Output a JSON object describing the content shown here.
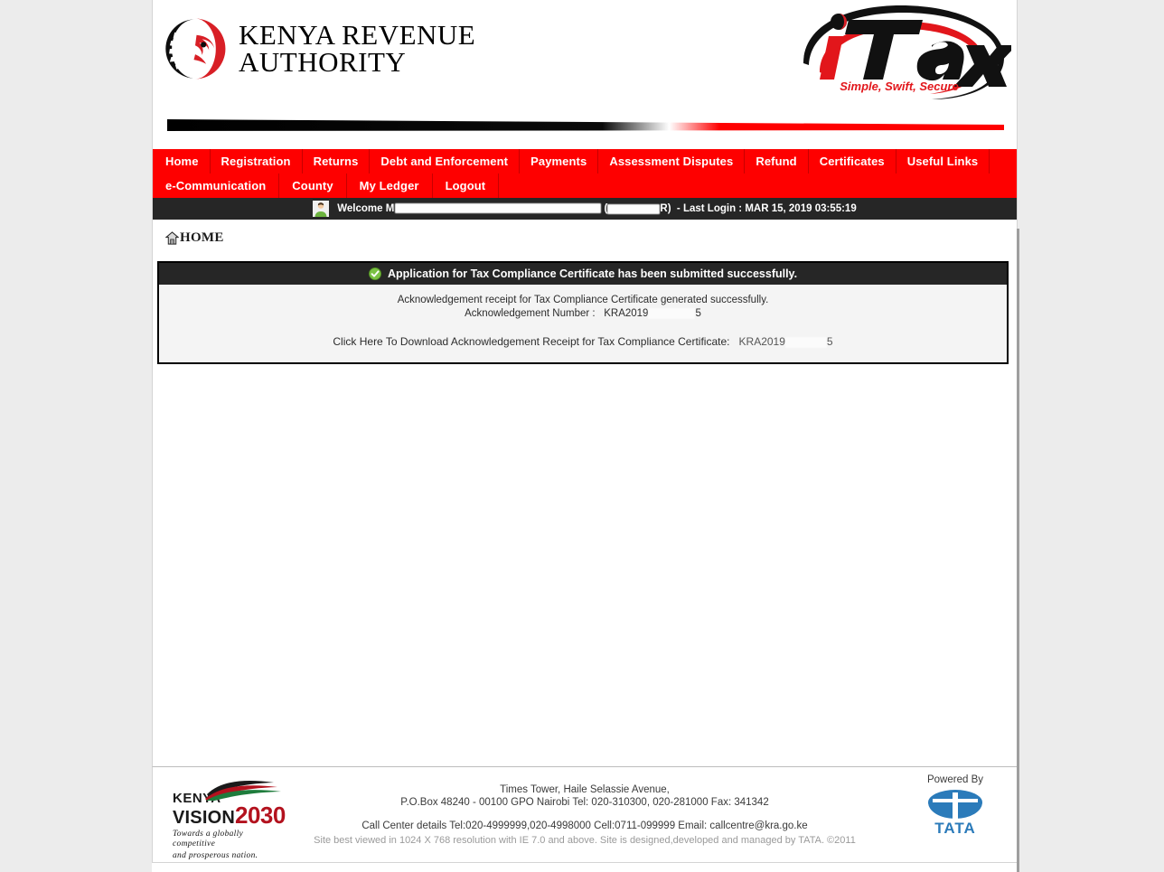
{
  "brand": {
    "kra_line1": "KENYA REVENUE",
    "kra_line2": "AUTHORITY",
    "itax_name": "iTax",
    "itax_tagline": "Simple, Swift, Secure",
    "accent_red": "#fe0000",
    "accent_dark": "#262626"
  },
  "nav": {
    "row1": [
      {
        "label": "Home"
      },
      {
        "label": "Registration"
      },
      {
        "label": "Returns"
      },
      {
        "label": "Debt and Enforcement"
      },
      {
        "label": "Payments"
      },
      {
        "label": "Assessment Disputes"
      },
      {
        "label": "Refund"
      },
      {
        "label": "Certificates"
      },
      {
        "label": "Useful Links"
      }
    ],
    "row2": [
      {
        "label": "e-Communication"
      },
      {
        "label": "County"
      },
      {
        "label": "My Ledger"
      },
      {
        "label": "Logout"
      }
    ]
  },
  "welcome": {
    "prefix": "Welcome",
    "name_visible_start": "M",
    "paren_open": "(",
    "paren_close": "R)",
    "separator": "-",
    "last_login_label": "Last Login :",
    "last_login_value": "MAR 15, 2019 03:55:19"
  },
  "breadcrumb": {
    "label": "HOME",
    "icon": "home-icon"
  },
  "message": {
    "icon": "success-check-icon",
    "title": "Application for Tax Compliance Certificate has been submitted successfully.",
    "line1": "Acknowledgement receipt for Tax Compliance Certificate generated successfully.",
    "line2_label": "Acknowledgement Number :",
    "ack_prefix": "KRA2019",
    "ack_suffix": "5",
    "download_text": "Click Here To Download Acknowledgement Receipt for Tax Compliance Certificate:",
    "download_ack_prefix": "KRA2019",
    "download_ack_suffix": "5"
  },
  "footer": {
    "vision": {
      "kenya": "KENYA",
      "vision": "VISION",
      "year": "2030",
      "tagline_line1": "Towards a globally competitive",
      "tagline_line2": "and prosperous nation."
    },
    "address_line1": "Times Tower, Haile Selassie Avenue,",
    "address_line2": "P.O.Box 48240 - 00100 GPO Nairobi Tel: 020-310300, 020-281000 Fax: 341342",
    "call_center": "Call Center details Tel:020-4999999,020-4998000 Cell:0711-099999 Email: callcentre@kra.go.ke",
    "disclaimer": "Site best viewed in 1024 X 768 resolution with IE 7.0 and above. Site is designed,developed and managed by TATA. ©2011",
    "powered_by": "Powered By",
    "vendor": "TATA"
  }
}
